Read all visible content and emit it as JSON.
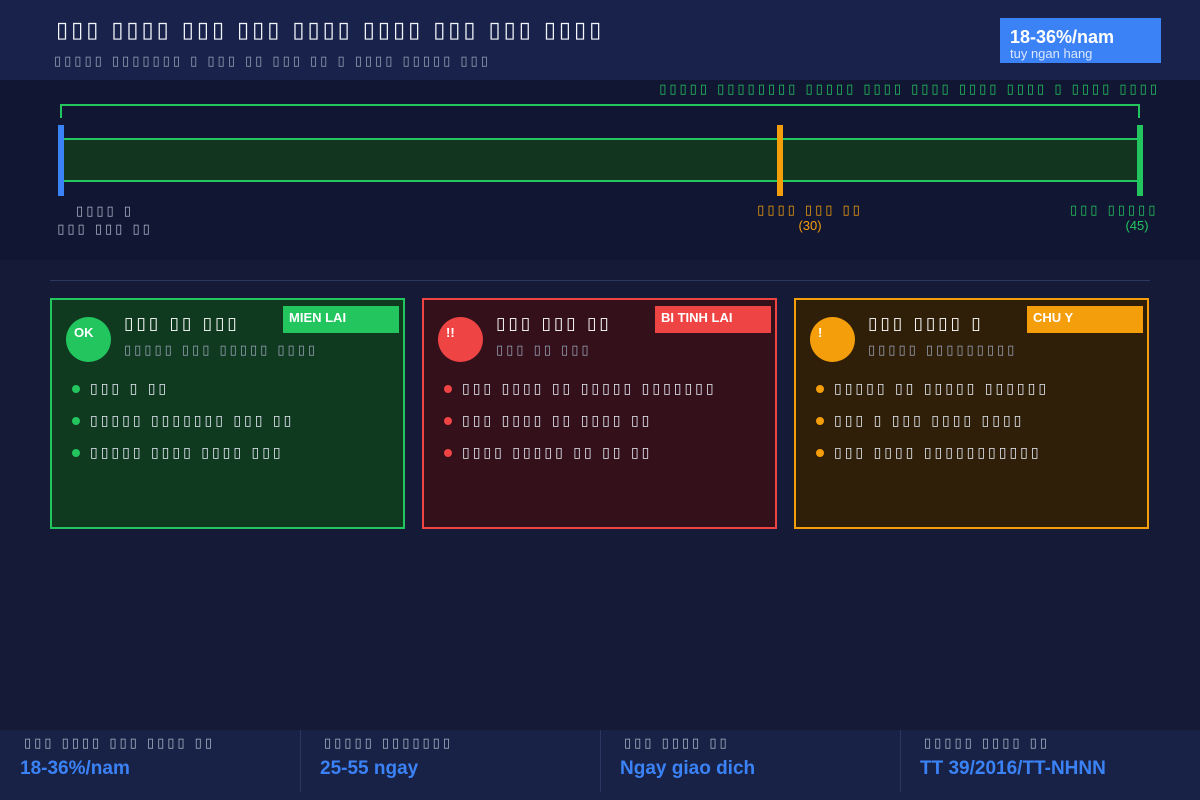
{
  "header": {
    "title": "▯▯▯ ▯▯▯▯ ▯▯▯ ▯▯▯ ▯▯▯▯ ▯▯▯▯ ▯▯▯ ▯▯▯ ▯▯▯▯",
    "subtitle": "▯▯▯▯▯ ▯▯▯▯▯▯▯ ▯ ▯▯▯ ▯▯ ▯▯▯ ▯▯ ▯ ▯▯▯▯ ▯▯▯▯▯ ▯▯▯",
    "rate_value": "18-36%/nam",
    "rate_caption": "tuy ngan hang"
  },
  "timeline": {
    "period_caption": "▯▯▯▯▯ ▯▯▯▯▯▯▯▯ ▯▯▯▯▯ ▯▯▯▯ ▯▯▯▯ ▯▯▯▯ ▯▯▯▯ ▯ ▯▯▯▯ ▯▯▯▯",
    "start_label_1": "▯▯▯▯ ▯",
    "start_label_2": "▯▯▯ ▯▯▯ ▯▯",
    "mid_label": "▯▯▯▯ ▯▯▯ ▯▯",
    "mid_value": "(30)",
    "end_label": "▯▯▯ ▯▯▯▯▯",
    "end_value": "(45)",
    "colors": {
      "start": "#3b82f6",
      "mid": "#f59e0b",
      "end": "#22c55e"
    }
  },
  "cards": [
    {
      "icon": "OK",
      "badge": "MIEN LAI",
      "title": "▯▯▯ ▯▯ ▯▯▯",
      "subtitle": "▯▯▯▯▯ ▯▯▯ ▯▯▯▯▯ ▯▯▯▯",
      "items": [
        "▯▯▯ ▯ ▯▯",
        "▯▯▯▯▯ ▯▯▯▯▯▯▯ ▯▯▯ ▯▯",
        "▯▯▯▯▯ ▯▯▯▯ ▯▯▯▯ ▯▯▯"
      ],
      "color": "#22c55e"
    },
    {
      "icon": "!!",
      "badge": "BI TINH LAI",
      "title": "▯▯▯ ▯▯▯ ▯▯",
      "subtitle": "▯▯▯ ▯▯ ▯▯▯",
      "items": [
        "▯▯▯ ▯▯▯▯ ▯▯ ▯▯▯▯▯ ▯▯▯▯▯▯▯",
        "▯▯▯ ▯▯▯▯ ▯▯ ▯▯▯▯ ▯▯",
        "▯▯▯▯ ▯▯▯▯▯ ▯▯ ▯▯ ▯▯"
      ],
      "color": "#ef4444"
    },
    {
      "icon": "!",
      "badge": "CHU Y",
      "title": "▯▯▯ ▯▯▯▯ ▯",
      "subtitle": "▯▯▯▯▯ ▯▯▯▯▯▯▯▯▯",
      "items": [
        "▯▯▯▯▯ ▯▯ ▯▯▯▯▯ ▯▯▯▯▯▯",
        "▯▯▯ ▯ ▯▯▯ ▯▯▯▯ ▯▯▯▯",
        "▯▯▯ ▯▯▯▯ ▯▯▯▯▯▯▯▯▯▯▯"
      ],
      "color": "#f59e0b"
    }
  ],
  "footer": [
    {
      "label": "▯▯▯ ▯▯▯▯ ▯▯▯ ▯▯▯▯ ▯▯",
      "value": "18-36%/nam"
    },
    {
      "label": "▯▯▯▯▯ ▯▯▯▯▯▯▯",
      "value": "25-55 ngay"
    },
    {
      "label": "▯▯▯ ▯▯▯▯ ▯▯",
      "value": "Ngay giao dich"
    },
    {
      "label": "▯▯▯▯▯ ▯▯▯▯ ▯▯",
      "value": "TT 39/2016/TT-NHNN"
    }
  ]
}
